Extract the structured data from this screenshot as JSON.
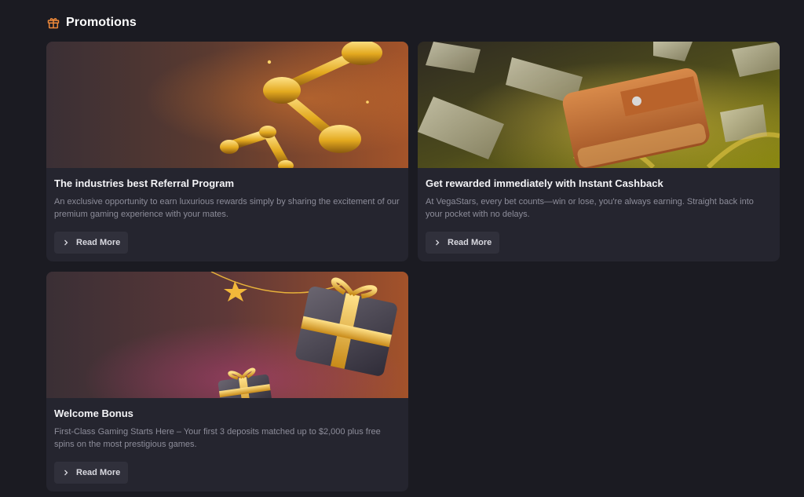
{
  "header": {
    "title": "Promotions",
    "icon": "gift-icon",
    "icon_color": "#f08a3a"
  },
  "promotions": [
    {
      "title": "The industries best Referral Program",
      "description": "An exclusive opportunity to earn luxurious rewards simply by sharing the excitement of our premium gaming experience with your mates.",
      "button": "Read More",
      "image": "referral-network-illustration"
    },
    {
      "title": "Get rewarded immediately with Instant Cashback",
      "description": "At VegaStars, every bet counts—win or lose, you're always earning. Straight back into your pocket with no delays.",
      "button": "Read More",
      "image": "wallet-cash-illustration"
    },
    {
      "title": "Welcome Bonus",
      "description": "First-Class Gaming Starts Here – Your first 3 deposits matched up to $2,000 plus free spins on the most prestigious games.",
      "button": "Read More",
      "image": "gift-boxes-illustration"
    }
  ],
  "colors": {
    "background": "#1b1b22",
    "card": "#25252f",
    "button": "#30303b",
    "accent": "#f08a3a",
    "muted_text": "#8d8d9a"
  }
}
